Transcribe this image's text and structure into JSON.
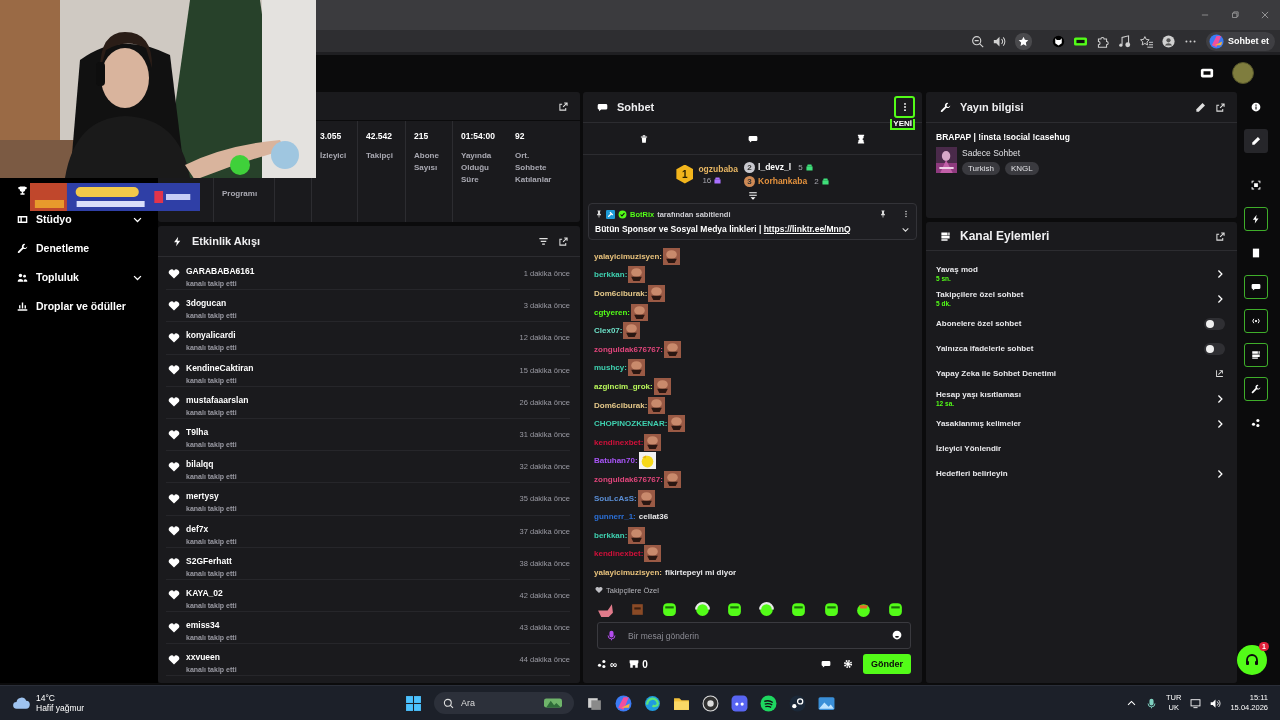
{
  "browser": {
    "chat_button": "Sohbet et"
  },
  "nav": [
    {
      "has_submenu": false
    },
    {
      "label": "Stüdyo",
      "has_submenu": true
    },
    {
      "label": "Denetleme",
      "has_submenu": false
    },
    {
      "label": "Topluluk",
      "has_submenu": true
    },
    {
      "label": "Droplar ve ödüller",
      "has_submenu": false
    }
  ],
  "stats": [
    {
      "label": "Programı"
    },
    {
      "value": "3.055",
      "label": "İzleyici"
    },
    {
      "value": "42.542",
      "label": "Takipçi"
    },
    {
      "value": "215",
      "label": "Abone Sayısı"
    },
    {
      "value": "01:54:00",
      "label": "Yayında Olduğu Süre"
    },
    {
      "value": "92",
      "label": "Ort. Sohbete Katılanlar"
    }
  ],
  "activity": {
    "title": "Etkinlik Akışı",
    "events": [
      {
        "user": "GARABABA6161",
        "action": "kanalı takip etti",
        "time": "1 dakika önce"
      },
      {
        "user": "3dogucan",
        "action": "kanalı takip etti",
        "time": "3 dakika önce"
      },
      {
        "user": "konyalicardi",
        "action": "kanalı takip etti",
        "time": "12 dakika önce"
      },
      {
        "user": "KendineCaktiran",
        "action": "kanalı takip etti",
        "time": "15 dakika önce"
      },
      {
        "user": "mustafaaarslan",
        "action": "kanalı takip etti",
        "time": "26 dakika önce"
      },
      {
        "user": "T9lha",
        "action": "kanalı takip etti",
        "time": "31 dakika önce"
      },
      {
        "user": "bilalqq",
        "action": "kanalı takip etti",
        "time": "32 dakika önce"
      },
      {
        "user": "mertysy",
        "action": "kanalı takip etti",
        "time": "35 dakika önce"
      },
      {
        "user": "def7x",
        "action": "kanalı takip etti",
        "time": "37 dakika önce"
      },
      {
        "user": "S2GFerhatt",
        "action": "kanalı takip etti",
        "time": "38 dakika önce"
      },
      {
        "user": "KAYA_02",
        "action": "kanalı takip etti",
        "time": "42 dakika önce"
      },
      {
        "user": "emiss34",
        "action": "kanalı takip etti",
        "time": "43 dakika önce"
      },
      {
        "user": "xxvueen",
        "action": "kanalı takip etti",
        "time": "44 dakika önce"
      }
    ]
  },
  "chat": {
    "title": "Sohbet",
    "new_badge": "YENİ",
    "leaderboard": [
      {
        "rank": "1",
        "name": "ogzubaba",
        "count": "16"
      },
      {
        "rank": "2",
        "name": "l_devz_l",
        "count": "5"
      },
      {
        "rank": "3",
        "name": "Korhankaba",
        "count": "2"
      }
    ],
    "pinned": {
      "author": "BotRix",
      "note": "tarafından sabitlendi",
      "text": "Bütün Sponsor ve Sosyal Medya linkleri | ",
      "link": "https://linktr.ee/MnnQ"
    },
    "messages": [
      {
        "user": "yalayicimuzisyen:",
        "color": "#e8c27c",
        "kind": "face-emote"
      },
      {
        "user": "berkkan:",
        "color": "#3fd1b0",
        "kind": "face-emote"
      },
      {
        "user": "Dom6ciburak:",
        "color": "#e6c98a",
        "kind": "face-emote"
      },
      {
        "user": "cgtyeren:",
        "color": "#53fc18",
        "kind": "face-emote"
      },
      {
        "user": "Clex07:",
        "color": "#6de0c8",
        "kind": "face-emote"
      },
      {
        "user": "zonguldak676767:",
        "color": "#e0457b",
        "kind": "face-emote"
      },
      {
        "user": "mushcy:",
        "color": "#3fd1b0",
        "kind": "face-emote"
      },
      {
        "user": "azgincim_grok:",
        "color": "#b8f55a",
        "kind": "face-emote"
      },
      {
        "user": "Dom6ciburak:",
        "color": "#e6c98a",
        "kind": "face-emote"
      },
      {
        "user": "CHOPINOZKENAR:",
        "color": "#3fd1b0",
        "kind": "face-emote"
      },
      {
        "user": "kendinexbet:",
        "color": "#d0103a",
        "kind": "face-emote"
      },
      {
        "user": "Batuhan70:",
        "color": "#a855f7",
        "kind": "duck-emote"
      },
      {
        "user": "zonguldak676767:",
        "color": "#e0457b",
        "kind": "face-emote"
      },
      {
        "user": "SouLcAsS:",
        "color": "#5b8fd6",
        "kind": "face-emote"
      },
      {
        "user": "gunnerr_1:",
        "color": "#2b6fd6",
        "kind": "text",
        "text": "cellat36"
      },
      {
        "user": "berkkan:",
        "color": "#3fd1b0",
        "kind": "face-emote"
      },
      {
        "user": "kendinexbet:",
        "color": "#d0103a",
        "kind": "face-emote"
      },
      {
        "user": "yalayicimuzisyen:",
        "color": "#e8c27c",
        "kind": "text",
        "text": "fikirtepeyi mi diyor"
      }
    ],
    "followers_only_label": "Takipçilere Özel",
    "input": {
      "placeholder": "Bir mesaj gönderin"
    },
    "points": "∞",
    "store_count": "0",
    "send_button": "Gönder"
  },
  "stream_info": {
    "title": "Yayın bilgisi",
    "stream_title": "BRAPAP | !insta !social !casehug",
    "category": "Sadece Sohbet",
    "tags": [
      "Turkish",
      "KNGL"
    ]
  },
  "channel_actions": {
    "title": "Kanal Eylemleri",
    "items": [
      {
        "kind": "arrow",
        "label": "Yavaş mod",
        "value": "5 sn."
      },
      {
        "kind": "arrow",
        "label": "Takipçilere özel sohbet",
        "value": "5 dk."
      },
      {
        "kind": "toggle",
        "label": "Abonelere özel sohbet",
        "on": false
      },
      {
        "kind": "toggle",
        "label": "Yalnızca ifadelerle sohbet",
        "on": false
      },
      {
        "kind": "external",
        "label": "Yapay Zeka ile Sohbet Denetimi"
      },
      {
        "kind": "arrow",
        "label": "Hesap yaşı kısıtlaması",
        "value": "12 sa."
      },
      {
        "kind": "arrow",
        "label": "Yasaklanmış kelimeler"
      },
      {
        "kind": "plain",
        "label": "İzleyici Yönlendir"
      },
      {
        "kind": "arrow",
        "label": "Hedefleri belirleyin"
      }
    ]
  },
  "rail": [
    {
      "selected": false,
      "open": false
    },
    {
      "selected": true,
      "open": false
    },
    {
      "selected": false,
      "open": false
    },
    {
      "selected": false,
      "open": true
    },
    {
      "selected": false,
      "open": false
    },
    {
      "selected": false,
      "open": true
    },
    {
      "selected": false,
      "open": true
    },
    {
      "selected": false,
      "open": true
    },
    {
      "selected": false,
      "open": true
    },
    {
      "selected": false,
      "open": false
    }
  ],
  "help_badge": "1",
  "taskbar": {
    "temperature": "14°C",
    "weather": "Hafif yağmur",
    "search_placeholder": "Ara",
    "language": "TUR",
    "layout": "UK",
    "time": "15:11",
    "date": "15.04.2026"
  }
}
